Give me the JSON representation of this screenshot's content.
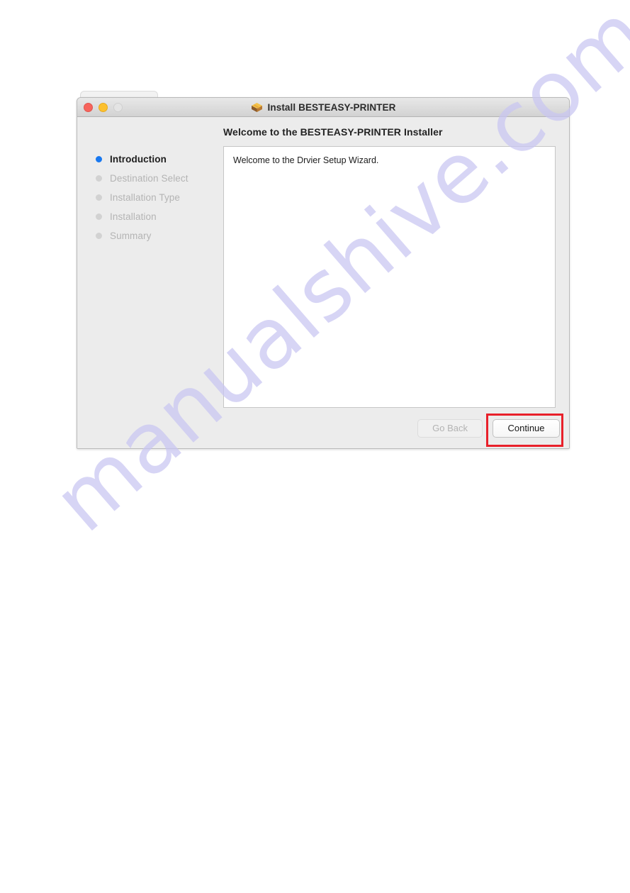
{
  "window": {
    "title": "Install BESTEASY-PRINTER",
    "icon": "package-icon",
    "traffic_lights": [
      {
        "name": "close",
        "color": "#f7645c"
      },
      {
        "name": "minimize",
        "color": "#fcc02e"
      },
      {
        "name": "zoom",
        "color": "#e4e4e4"
      }
    ]
  },
  "sidebar": {
    "steps": [
      {
        "label": "Introduction",
        "active": true
      },
      {
        "label": "Destination Select",
        "active": false
      },
      {
        "label": "Installation Type",
        "active": false
      },
      {
        "label": "Installation",
        "active": false
      },
      {
        "label": "Summary",
        "active": false
      }
    ]
  },
  "main": {
    "heading": "Welcome to the BESTEASY-PRINTER Installer",
    "body_text": "Welcome to the Drvier Setup Wizard."
  },
  "footer": {
    "go_back_label": "Go Back",
    "continue_label": "Continue"
  },
  "annotation": {
    "highlight_color": "#e8202a",
    "target": "continue-button"
  },
  "watermark": {
    "text": "manualshive.com",
    "color": "#c9c6f2"
  }
}
